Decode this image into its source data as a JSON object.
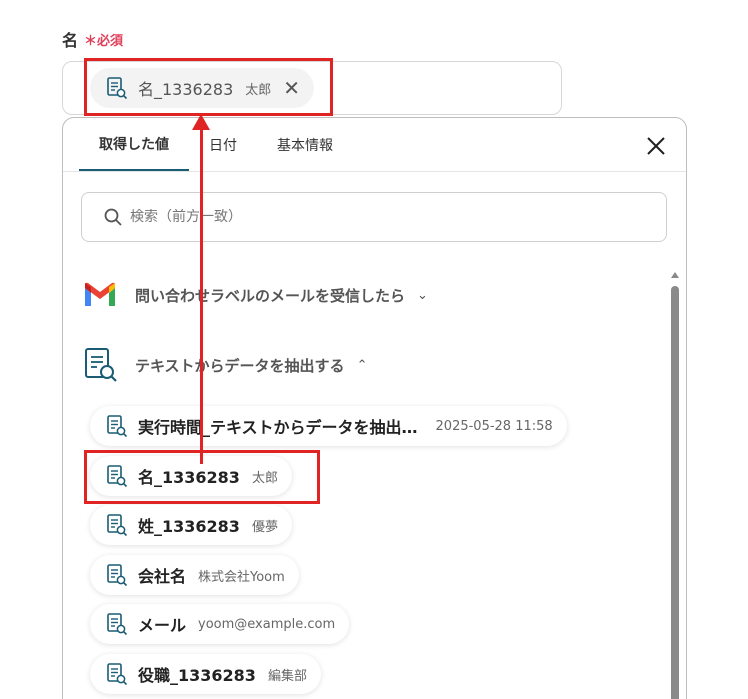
{
  "field": {
    "label": "名",
    "required": "＊必須",
    "selected_chip": {
      "name": "名_1336283",
      "value": "太郎"
    }
  },
  "panel": {
    "tabs": [
      {
        "label": "取得した値",
        "active": true
      },
      {
        "label": "日付",
        "active": false
      },
      {
        "label": "基本情報",
        "active": false
      }
    ],
    "search_placeholder": "検索（前方一致）",
    "sections": [
      {
        "label": "問い合わせラベルのメールを受信したら",
        "icon": "gmail-icon",
        "expanded": false
      },
      {
        "label": "テキストからデータを抽出する",
        "icon": "document-search-icon",
        "expanded": true
      }
    ],
    "items": [
      {
        "name": "実行時間_テキストからデータを抽出…",
        "value": "2025-05-28 11:58"
      },
      {
        "name": "名_1336283",
        "value": "太郎"
      },
      {
        "name": "姓_1336283",
        "value": "優夢"
      },
      {
        "name": "会社名",
        "value": "株式会社Yoom"
      },
      {
        "name": "メール",
        "value": "yoom@example.com"
      },
      {
        "name": "役職_1336283",
        "value": "編集部"
      }
    ]
  },
  "colors": {
    "accent": "#1a5c73",
    "highlight": "#e02424",
    "required": "#e0405a"
  }
}
